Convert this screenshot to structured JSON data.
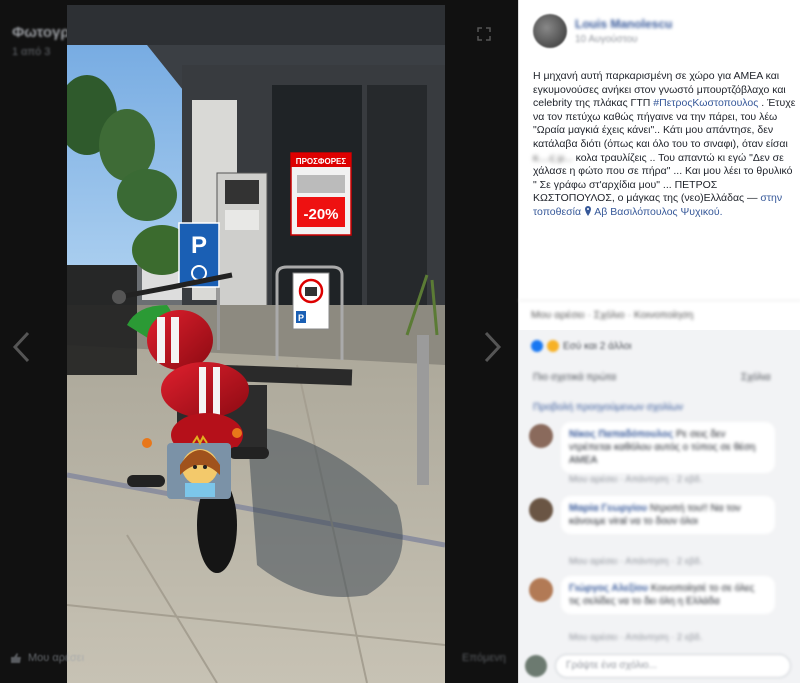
{
  "viewer": {
    "header_title": "Φωτογραφίες χρονολογίου",
    "header_sub": "1 από 3",
    "footer_left": "Μου αρέσει",
    "footer_right": "Επόμενη"
  },
  "photo": {
    "promo_sign_title": "ΠΡΟΣΦΟΡΕΣ",
    "promo_sign_discount": "-20%",
    "parking_sign": "P",
    "bottom_sign": "P",
    "colors": {
      "bike_red": "#c8101c",
      "ground": "#b9b4a7",
      "sky": "#7fb2e6"
    }
  },
  "post": {
    "author": "Louis Manolescu",
    "time": "10 Αυγούστου",
    "text_intro": "Η μηχανή αυτή παρκαρισμένη σε χώρο για ΑΜΕΑ και εγκυμονούσες ανήκει στον γνωστό μπουρτζόβλαχο και celebrity της πλάκας ΓΤΠ",
    "hashtag": "#ΠετροςΚωστοπουλος",
    "text_mid": ". Έτυχε να τον πετύχω καθώς πήγαινε να την πάρει, του λέω \"Ωραία μαγκιά έχεις κάνει\".. Κάτι μου απάντησε, δεν κατάλαβα διότι (όπως και όλο του το σιναφι), όταν είσαι",
    "censored_1": "κ....ς",
    "censored_2": "μ...",
    "text_end": "κολα τραυλίζεις .. Του απαντώ κι εγώ \"Δεν σε χάλασε η φώτο που σε πήρα\" ... Και μου λέει το θρυλικό \" Σε γράφω στ'αρχίδια μου\" ... ΠΕΤΡΟΣ ΚΩΣΤΟΠΟΥΛΟΣ, ο μάγκας της (νεο)Ελλάδας —",
    "location_prefix": "στην τοποθεσία",
    "location": "Αβ Βασιλόπουλος Ψυχικού."
  },
  "actions": {
    "bar_text": "Μου αρέσει · Σχόλιο · Κοινοποίηση"
  },
  "reactions": {
    "summary": "Εσύ και 2 άλλοι"
  },
  "comments_area": {
    "sort_left": "Πιο σχετικά πρώτα",
    "sort_right": "Σχόλια",
    "more_comments": "Προβολή προηγούμενων σχολίων",
    "items": [
      {
        "name": "Νίκος Παπαδόπουλος",
        "text": "Ρε σεις δεν ντρέπεται καθόλου αυτός ο τύπος σε θέση ΑΜΕΑ",
        "meta": "Μου αρέσει · Απάντηση · 2 εβδ."
      },
      {
        "name": "Μαρία Γεωργίου",
        "text": "Ντροπή του!! Να τον κάνουμε viral να το δουν όλοι",
        "meta": "Μου αρέσει · Απάντηση · 2 εβδ."
      },
      {
        "name": "Γιώργος Αλεξίου",
        "text": "Κοινοποίησέ το σε όλες τις σελίδες να το δει όλη η Ελλάδα",
        "meta": "Μου αρέσει · Απάντηση · 2 εβδ."
      }
    ]
  },
  "write": {
    "placeholder": "Γράψτε ένα σχόλιο..."
  }
}
